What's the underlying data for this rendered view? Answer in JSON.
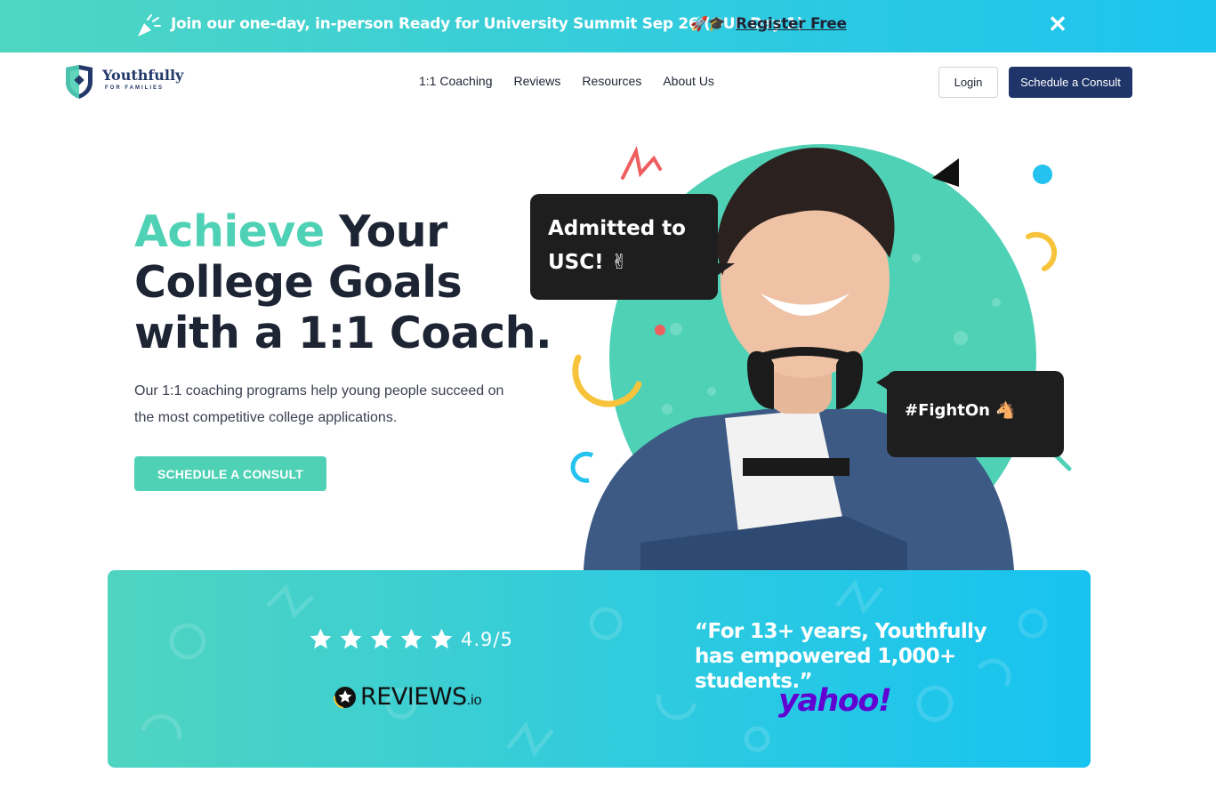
{
  "banner": {
    "text": "Join our one-day, in-person Ready for University Summit Sep 26 (OUF Day 1)",
    "emoji": "🚀🎓",
    "link_label": "Register Free",
    "close_label": "✕"
  },
  "header": {
    "logo_word": "Youthfully",
    "logo_sub": "FOR FAMILIES",
    "nav": [
      "1:1 Coaching",
      "Reviews",
      "Resources",
      "About Us"
    ],
    "login_label": "Login",
    "consult_label": "Schedule a Consult"
  },
  "hero": {
    "title_accent": "Achieve",
    "title_line1_rest": " Your",
    "title_line2": "College Goals",
    "title_line3": "with a 1:1 Coach.",
    "subtitle": "Our 1:1 coaching programs help young people succeed on the most competitive college applications.",
    "cta_label": "SCHEDULE A CONSULT",
    "bubble_1_line1": "Admitted to",
    "bubble_1_line2": "USC! ✌",
    "bubble_2": "#FightOn 🐴"
  },
  "stats": {
    "star_count": 5,
    "rating": "4.9/5",
    "reviews_word": "REVIEWS",
    "reviews_suffix": ".io",
    "quote": "“For 13+ years, Youthfully has empowered 1,000+ students.”",
    "yahoo": "yahoo!"
  },
  "colors": {
    "accent": "#4fd1b5",
    "navy": "#1f3468",
    "banner_gradient_start": "#4fd6c2",
    "banner_gradient_end": "#1cc4ee",
    "yahoo_purple": "#6001d2"
  }
}
